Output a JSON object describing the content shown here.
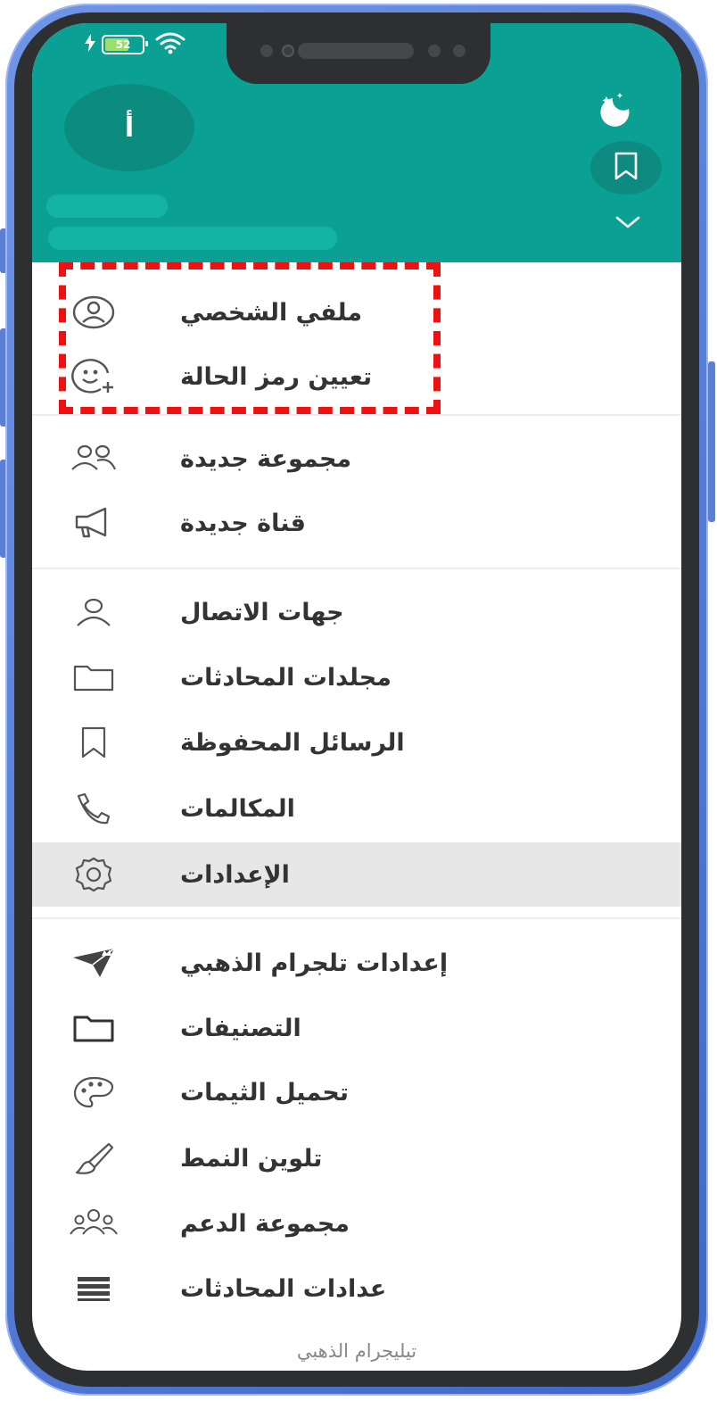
{
  "status": {
    "battery": "52"
  },
  "profile": {
    "avatar_letter": "أ"
  },
  "menu": {
    "section1": [
      {
        "label": "ملفي الشخصي",
        "icon": "profile-icon"
      },
      {
        "label": "تعيين رمز الحالة",
        "icon": "emoji-status-icon"
      }
    ],
    "section2": [
      {
        "label": "مجموعة جديدة",
        "icon": "group-icon"
      },
      {
        "label": "قناة جديدة",
        "icon": "megaphone-icon"
      }
    ],
    "section3": [
      {
        "label": "جهات الاتصال",
        "icon": "person-icon"
      },
      {
        "label": "مجلدات المحادثات",
        "icon": "folder-icon"
      },
      {
        "label": "الرسائل المحفوظة",
        "icon": "bookmark-icon"
      },
      {
        "label": "المكالمات",
        "icon": "phone-icon"
      },
      {
        "label": "الإعدادات",
        "icon": "gear-icon"
      }
    ],
    "section4": [
      {
        "label": "إعدادات تلجرام الذهبي",
        "icon": "paper-plane-crown-icon"
      },
      {
        "label": "التصنيفات",
        "icon": "folder-solid-icon"
      },
      {
        "label": "تحميل الثيمات",
        "icon": "palette-icon"
      },
      {
        "label": "تلوين النمط",
        "icon": "brush-icon"
      },
      {
        "label": "مجموعة الدعم",
        "icon": "support-group-icon"
      },
      {
        "label": "عدادات المحادثات",
        "icon": "list-icon"
      }
    ]
  },
  "footer": {
    "text": "تيليجرام الذهبي"
  },
  "colors": {
    "header": "#0aa093",
    "highlight": "#ef1111",
    "frame": "#4f77d6"
  }
}
